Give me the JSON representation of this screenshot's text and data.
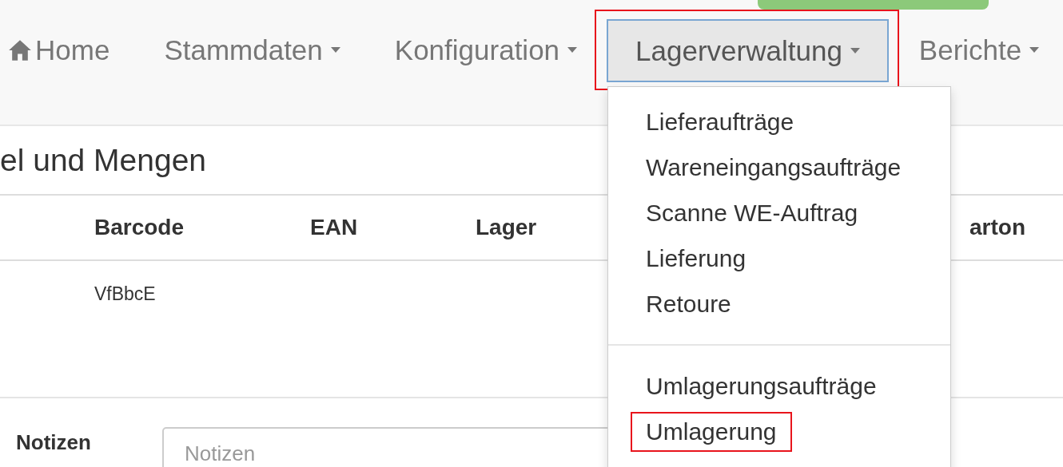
{
  "navbar": {
    "items": [
      {
        "label": "Home",
        "kind": "home",
        "expanded": false,
        "highlighted": false
      },
      {
        "label": "Stammdaten",
        "kind": "dropdown",
        "expanded": false,
        "highlighted": false
      },
      {
        "label": "Konfiguration",
        "kind": "dropdown",
        "expanded": false,
        "highlighted": false
      },
      {
        "label": "Lagerverwaltung",
        "kind": "dropdown",
        "expanded": true,
        "highlighted": true
      },
      {
        "label": "Berichte",
        "kind": "dropdown",
        "expanded": false,
        "highlighted": false
      }
    ]
  },
  "dropdown_menu": {
    "groups": [
      [
        {
          "label": "Lieferaufträge",
          "highlighted": false
        },
        {
          "label": "Wareneingangsaufträge",
          "highlighted": false
        },
        {
          "label": "Scanne WE-Auftrag",
          "highlighted": false
        },
        {
          "label": "Lieferung",
          "highlighted": false
        },
        {
          "label": "Retoure",
          "highlighted": false
        }
      ],
      [
        {
          "label": "Umlagerungsaufträge",
          "highlighted": false
        },
        {
          "label": "Umlagerung",
          "highlighted": true
        }
      ]
    ]
  },
  "heading": "el und Mengen",
  "table": {
    "columns": [
      "",
      "Barcode",
      "EAN",
      "Lager",
      "",
      "arton"
    ],
    "rows": [
      [
        "",
        "VfBbcE",
        "",
        "",
        "",
        ""
      ]
    ]
  },
  "notes": {
    "label": "Notizen",
    "placeholder": "Notizen"
  }
}
